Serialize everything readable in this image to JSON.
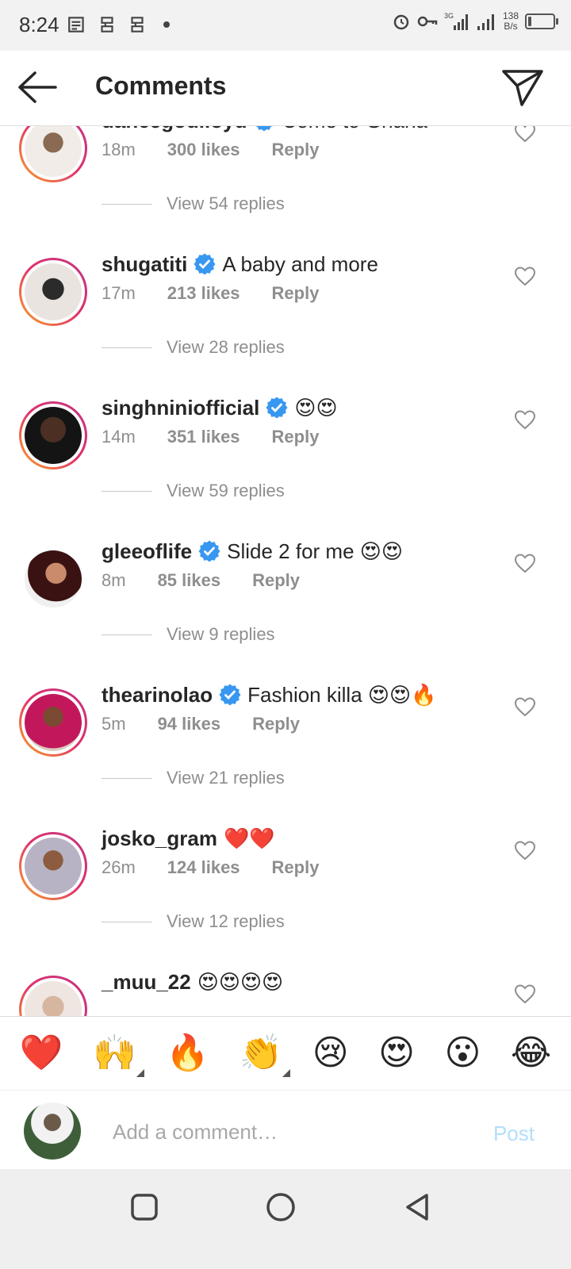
{
  "status": {
    "time": "8:24",
    "net_speed_value": "138",
    "net_speed_unit": "B/s",
    "network": "3G",
    "battery_level": 0.12
  },
  "header": {
    "title": "Comments"
  },
  "comments": [
    {
      "username": "dancegodlloyd",
      "verified": true,
      "text": "Come to Ghana",
      "time": "18m",
      "likes": "300 likes",
      "reply": "Reply",
      "view_replies": "View 54 replies"
    },
    {
      "username": "shugatiti",
      "verified": true,
      "text": "A baby and more",
      "time": "17m",
      "likes": "213 likes",
      "reply": "Reply",
      "view_replies": "View 28 replies"
    },
    {
      "username": "singhniniofficial",
      "verified": true,
      "text": "😍😍",
      "time": "14m",
      "likes": "351 likes",
      "reply": "Reply",
      "view_replies": "View 59 replies"
    },
    {
      "username": "gleeoflife",
      "verified": true,
      "text": "Slide 2 for me 😍😍",
      "time": "8m",
      "likes": "85 likes",
      "reply": "Reply",
      "view_replies": "View 9 replies"
    },
    {
      "username": "thearinolao",
      "verified": true,
      "text": "Fashion killa 😍😍🔥",
      "time": "5m",
      "likes": "94 likes",
      "reply": "Reply",
      "view_replies": "View 21 replies"
    },
    {
      "username": "josko_gram",
      "verified": false,
      "text": "❤️❤️",
      "time": "26m",
      "likes": "124 likes",
      "reply": "Reply",
      "view_replies": "View 12 replies"
    },
    {
      "username": "_muu_22",
      "verified": false,
      "text": "😍😍😍😍",
      "time": "",
      "likes": "",
      "reply": "",
      "view_replies": ""
    }
  ],
  "emoji_bar": [
    "❤️",
    "🙌",
    "🔥",
    "👏",
    "😢",
    "😍",
    "😮",
    "😂"
  ],
  "composer": {
    "placeholder": "Add a comment…",
    "post_label": "Post"
  },
  "colors": {
    "accent": "#0095f6",
    "post_disabled": "#b2dffc",
    "verified": "#3897f0",
    "meta_text": "#8e8e8e"
  }
}
